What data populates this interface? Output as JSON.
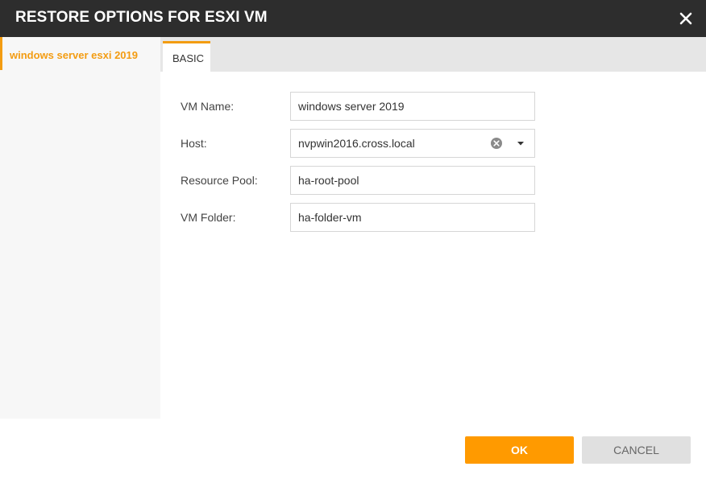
{
  "dialog": {
    "title": "RESTORE OPTIONS FOR ESXI VM"
  },
  "sidebar": {
    "items": [
      {
        "label": "windows server esxi 2019",
        "selected": true
      }
    ]
  },
  "tabs": [
    {
      "label": "BASIC",
      "active": true
    }
  ],
  "form": {
    "vm_name": {
      "label": "VM Name:",
      "value": "windows server 2019"
    },
    "host": {
      "label": "Host:",
      "value": "nvpwin2016.cross.local",
      "icons": [
        "clear-icon",
        "chevron-down-icon"
      ]
    },
    "resource_pool": {
      "label": "Resource Pool:",
      "value": "ha-root-pool"
    },
    "vm_folder": {
      "label": "VM Folder:",
      "value": "ha-folder-vm"
    }
  },
  "buttons": {
    "ok_label": "OK",
    "cancel_label": "CANCEL"
  },
  "colors": {
    "titlebar": "#2d2d2d",
    "accent": "#ff9a00",
    "sidebar_bg": "#f7f7f7",
    "tabbar_bg": "#e6e6e6",
    "cancel_bg": "#e0e0e0"
  }
}
